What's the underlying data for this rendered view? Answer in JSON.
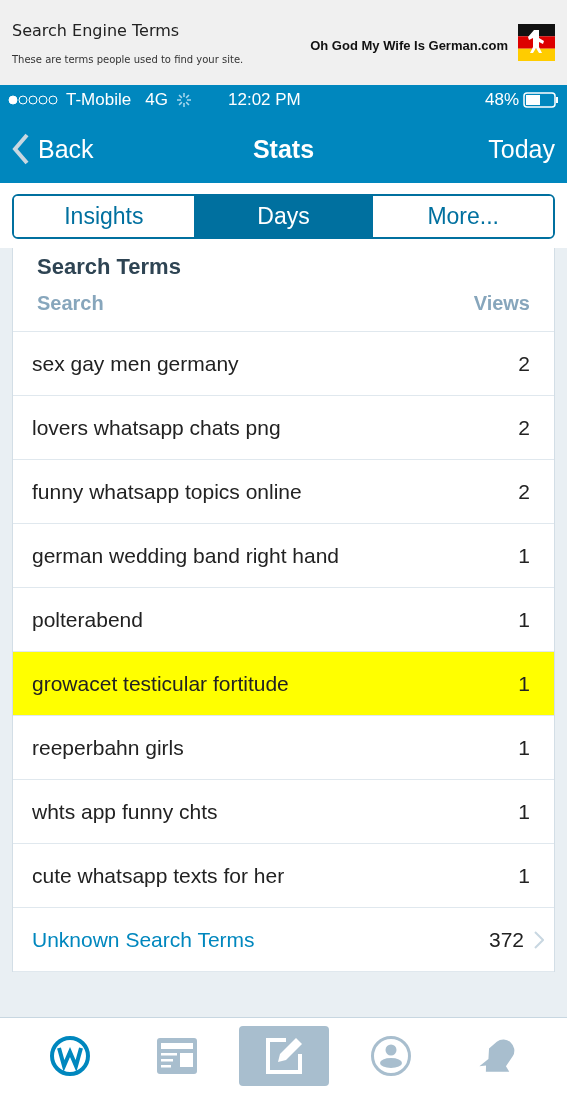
{
  "banner": {
    "title": "Search Engine Terms",
    "subtitle": "These are terms people used to find your site.",
    "site": "Oh God My Wife Is German.com"
  },
  "status_bar": {
    "carrier": "T-Mobile",
    "network": "4G",
    "time": "12:02 PM",
    "battery": "48%"
  },
  "nav": {
    "back": "Back",
    "title": "Stats",
    "right": "Today"
  },
  "segments": [
    {
      "label": "Insights",
      "selected": false
    },
    {
      "label": "Days",
      "selected": true
    },
    {
      "label": "More...",
      "selected": false
    }
  ],
  "section": {
    "title": "Search Terms",
    "col_left": "Search",
    "col_right": "Views"
  },
  "rows": [
    {
      "kind": "term",
      "term": "sex gay men germany",
      "views": "2",
      "highlighted": false
    },
    {
      "kind": "term",
      "term": "lovers whatsapp chats png",
      "views": "2",
      "highlighted": false
    },
    {
      "kind": "term",
      "term": "funny whatsapp topics online",
      "views": "2",
      "highlighted": false
    },
    {
      "kind": "term",
      "term": "german wedding band right hand",
      "views": "1",
      "highlighted": false
    },
    {
      "kind": "term",
      "term": "polterabend",
      "views": "1",
      "highlighted": false
    },
    {
      "kind": "term",
      "term": "growacet testicular fortitude",
      "views": "1",
      "highlighted": true
    },
    {
      "kind": "term",
      "term": "reeperbahn girls",
      "views": "1",
      "highlighted": false
    },
    {
      "kind": "term",
      "term": "whts app funny chts",
      "views": "1",
      "highlighted": false
    },
    {
      "kind": "term",
      "term": "cute whatsapp texts for her",
      "views": "1",
      "highlighted": false
    },
    {
      "kind": "link",
      "term": "Unknown Search Terms",
      "views": "372",
      "highlighted": false
    }
  ],
  "tab_bar": [
    {
      "selected": false
    },
    {
      "selected": false
    },
    {
      "selected": true
    },
    {
      "selected": false
    },
    {
      "selected": false
    }
  ]
}
